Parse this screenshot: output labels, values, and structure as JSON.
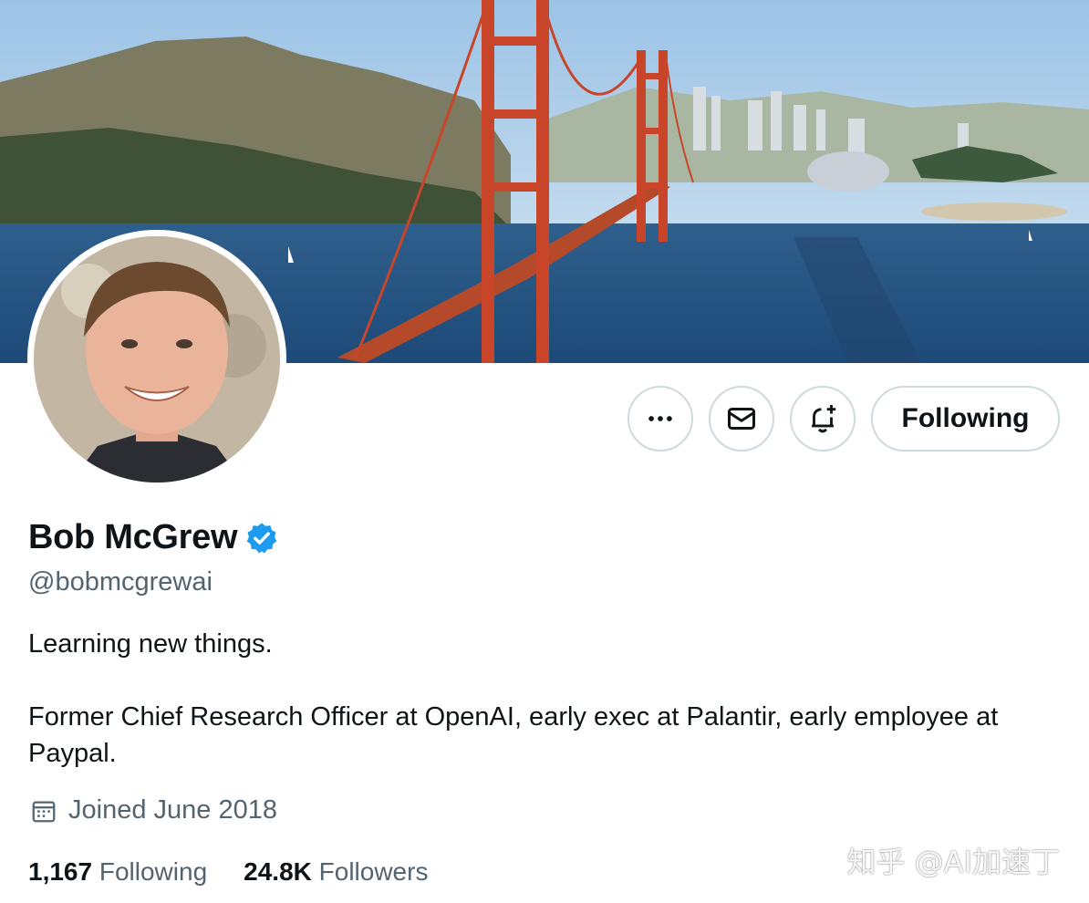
{
  "profile": {
    "name": "Bob McGrew",
    "handle": "@bobmcgrewai",
    "verified": true,
    "bio_line1": "Learning new things.",
    "bio_line2": "Former Chief Research Officer at OpenAI, early exec at Palantir, early employee at Paypal.",
    "joined": "Joined June 2018",
    "following_count": "1,167",
    "following_label": "Following",
    "followers_count": "24.8K",
    "followers_label": "Followers"
  },
  "actions": {
    "more_icon": "more-icon",
    "message_icon": "envelope-icon",
    "notify_icon": "bell-plus-icon",
    "follow_button_label": "Following"
  },
  "watermark": "知乎 @AI加速丁",
  "colors": {
    "verified_badge": "#1d9bf0",
    "secondary_text": "#536471",
    "border": "#cfd9de"
  }
}
